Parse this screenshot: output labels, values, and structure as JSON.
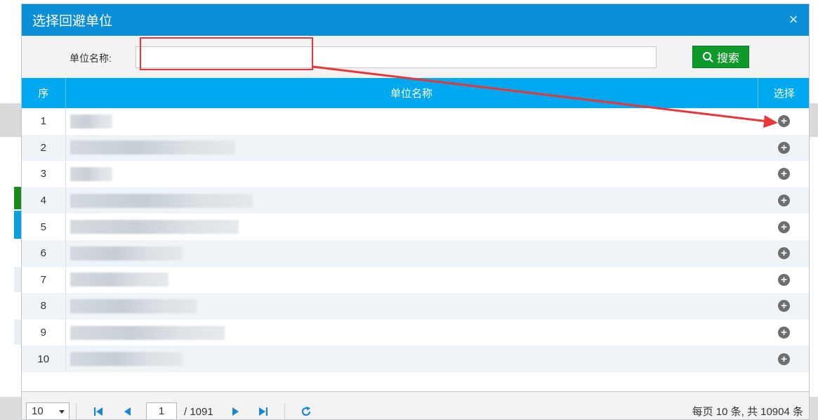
{
  "dialog": {
    "title": "选择回避单位",
    "close_glyph": "×"
  },
  "search": {
    "label": "单位名称:",
    "value": "",
    "placeholder": "",
    "button_label": "搜索"
  },
  "table": {
    "headers": {
      "index": "序",
      "name": "单位名称",
      "select": "选择"
    },
    "rows": [
      {
        "index": "1",
        "name": ""
      },
      {
        "index": "2",
        "name": ""
      },
      {
        "index": "3",
        "name": ""
      },
      {
        "index": "4",
        "name": ""
      },
      {
        "index": "5",
        "name": ""
      },
      {
        "index": "6",
        "name": ""
      },
      {
        "index": "7",
        "name": ""
      },
      {
        "index": "8",
        "name": ""
      },
      {
        "index": "9",
        "name": ""
      },
      {
        "index": "10",
        "name": ""
      }
    ],
    "select_icon": "plus-circle-icon"
  },
  "pagination": {
    "page_size": "10",
    "current_page": "1",
    "total_pages": "/ 1091",
    "summary": "每页 10 条, 共 10904 条"
  },
  "colors": {
    "title_bar": "#0a8fd6",
    "header": "#00a8ef",
    "search_button": "#0e9a2a",
    "annotation": "#e8363a"
  }
}
